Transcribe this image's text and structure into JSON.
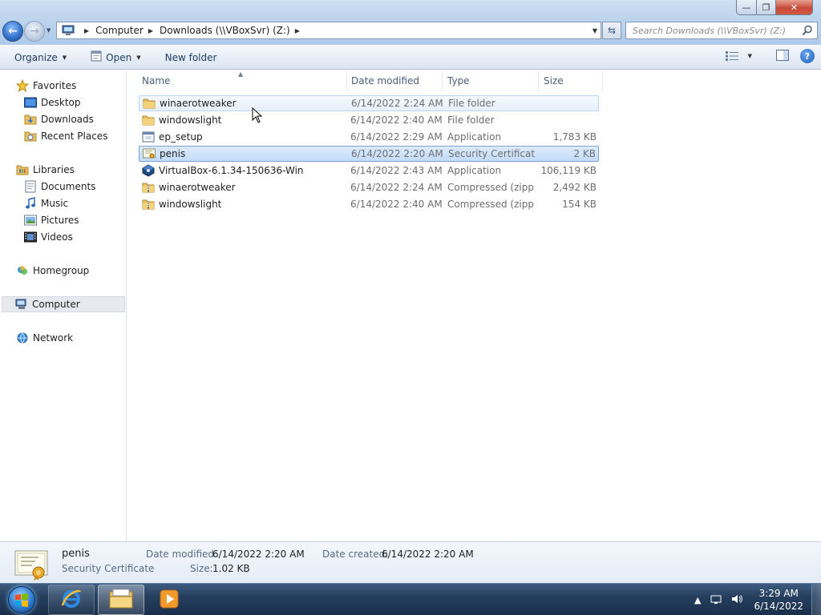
{
  "window": {
    "minimize_glyph": "—",
    "maximize_glyph": "❐",
    "close_glyph": "✕"
  },
  "address": {
    "breadcrumbs": [
      "Computer",
      "Downloads (\\\\VBoxSvr) (Z:)"
    ],
    "search_placeholder": "Search Downloads (\\\\VBoxSvr) (Z:)"
  },
  "toolbar": {
    "organize_label": "Organize",
    "open_label": "Open",
    "new_folder_label": "New folder"
  },
  "nav": {
    "favorites": "Favorites",
    "desktop": "Desktop",
    "downloads": "Downloads",
    "recent_places": "Recent Places",
    "libraries": "Libraries",
    "documents": "Documents",
    "music": "Music",
    "pictures": "Pictures",
    "videos": "Videos",
    "homegroup": "Homegroup",
    "computer": "Computer",
    "network": "Network"
  },
  "columns": {
    "name": "Name",
    "date": "Date modified",
    "type": "Type",
    "size": "Size"
  },
  "files": [
    {
      "name": "winaerotweaker",
      "date": "6/14/2022 2:24 AM",
      "type": "File folder",
      "size": "",
      "icon": "folder-icon"
    },
    {
      "name": "windowslight",
      "date": "6/14/2022 2:40 AM",
      "type": "File folder",
      "size": "",
      "icon": "folder-icon"
    },
    {
      "name": "ep_setup",
      "date": "6/14/2022 2:29 AM",
      "type": "Application",
      "size": "1,783 KB",
      "icon": "application-icon"
    },
    {
      "name": "penis",
      "date": "6/14/2022 2:20 AM",
      "type": "Security Certificate",
      "size": "2 KB",
      "icon": "certificate-icon"
    },
    {
      "name": "VirtualBox-6.1.34-150636-Win",
      "date": "6/14/2022 2:43 AM",
      "type": "Application",
      "size": "106,119 KB",
      "icon": "virtualbox-icon"
    },
    {
      "name": "winaerotweaker",
      "date": "6/14/2022 2:24 AM",
      "type": "Compressed (zipp...",
      "size": "2,492 KB",
      "icon": "zip-folder-icon"
    },
    {
      "name": "windowslight",
      "date": "6/14/2022 2:40 AM",
      "type": "Compressed (zipp...",
      "size": "154 KB",
      "icon": "zip-folder-icon"
    }
  ],
  "details": {
    "name": "penis",
    "type": "Security Certificate",
    "date_modified_label": "Date modified:",
    "date_modified": "6/14/2022 2:20 AM",
    "date_created_label": "Date created:",
    "date_created": "6/14/2022 2:20 AM",
    "size_label": "Size:",
    "size": "1.02 KB"
  },
  "taskbar": {
    "time": "3:29 AM",
    "date": "6/14/2022"
  }
}
